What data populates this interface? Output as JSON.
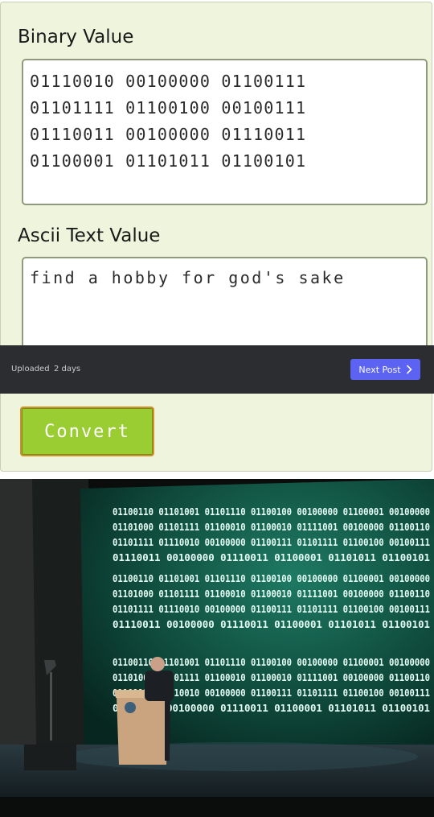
{
  "converter": {
    "binary_label": "Binary Value",
    "binary_lines": [
      "01110010 00100000 01100111",
      "01101111 01100100 00100111",
      "01110011 00100000 01110011",
      "01100001 01101011 01100101"
    ],
    "ascii_label": "Ascii Text Value",
    "ascii_value": "find a hobby for god's sake",
    "convert_label": "Convert"
  },
  "post_bar": {
    "uploaded_label": "Uploaded",
    "uploaded_age": "2 days",
    "next_label": "Next Post",
    "next_icon": "chevron-right-icon"
  },
  "photo": {
    "screen_blocks": [
      [
        "01100110 01101001 01101110 01100100 00100000 01100001 00100000",
        "01101000 01101111 01100010 01100010 01111001 00100000 01100110",
        "01101111 01110010 00100000 01100111 01101111 01100100 00100111",
        "01110011 00100000 01110011 01100001 01101011 01100101"
      ],
      [
        "01100110 01101001 01101110 01100100 00100000 01100001 00100000",
        "01101000 01101111 01100010 01100010 01111001 00100000 01100110",
        "01101111 01110010 00100000 01100111 01101111 01100100 00100111",
        "01110011 00100000 01110011 01100001 01101011 01100101"
      ],
      [
        "01100110 01101001 01101110 01100100 00100000 01100001 00100000",
        "01101000 01101111 01100010 01100010 01111001 00100000 01100110",
        "01101111 01110010 00100000 01100111 01101111 01100100 00100111",
        "01110011 00100000 01110011 01100001 01101011 01100101"
      ]
    ]
  },
  "colors": {
    "panel_bg": "#eef5dc",
    "convert_bg": "#9acd32",
    "next_btn": "#5c63f2",
    "bar_bg": "#2b2d31",
    "screen_text": "#d8fff0",
    "screen_bg": "#0f4a3c"
  }
}
